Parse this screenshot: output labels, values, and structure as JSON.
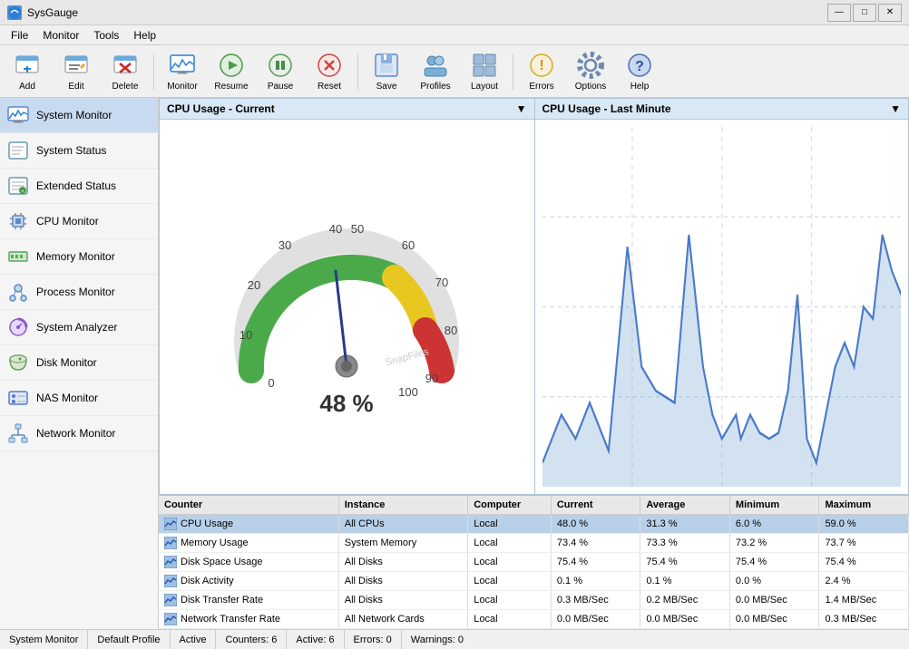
{
  "titleBar": {
    "title": "SysGauge",
    "minBtn": "—",
    "maxBtn": "□",
    "closeBtn": "✕"
  },
  "menuBar": {
    "items": [
      "File",
      "Monitor",
      "Tools",
      "Help"
    ]
  },
  "toolbar": {
    "buttons": [
      {
        "id": "add",
        "label": "Add"
      },
      {
        "id": "edit",
        "label": "Edit"
      },
      {
        "id": "delete",
        "label": "Delete"
      },
      {
        "id": "monitor",
        "label": "Monitor"
      },
      {
        "id": "resume",
        "label": "Resume"
      },
      {
        "id": "pause",
        "label": "Pause"
      },
      {
        "id": "reset",
        "label": "Reset"
      },
      {
        "id": "save",
        "label": "Save"
      },
      {
        "id": "profiles",
        "label": "Profiles"
      },
      {
        "id": "layout",
        "label": "Layout"
      },
      {
        "id": "errors",
        "label": "Errors"
      },
      {
        "id": "options",
        "label": "Options"
      },
      {
        "id": "help",
        "label": "Help"
      }
    ]
  },
  "sidebar": {
    "items": [
      {
        "id": "system-monitor",
        "label": "System Monitor",
        "active": true
      },
      {
        "id": "system-status",
        "label": "System Status"
      },
      {
        "id": "extended-status",
        "label": "Extended Status"
      },
      {
        "id": "cpu-monitor",
        "label": "CPU Monitor"
      },
      {
        "id": "memory-monitor",
        "label": "Memory Monitor"
      },
      {
        "id": "process-monitor",
        "label": "Process Monitor"
      },
      {
        "id": "system-analyzer",
        "label": "System Analyzer"
      },
      {
        "id": "disk-monitor",
        "label": "Disk Monitor"
      },
      {
        "id": "nas-monitor",
        "label": "NAS Monitor"
      },
      {
        "id": "network-monitor",
        "label": "Network Monitor"
      }
    ]
  },
  "charts": {
    "left": {
      "title": "CPU Usage - Current",
      "gaugeValue": 48,
      "gaugeLabel": "48 %",
      "min": 0,
      "max": 100
    },
    "right": {
      "title": "CPU Usage - Last Minute"
    }
  },
  "table": {
    "headers": [
      "Counter",
      "Instance",
      "Computer",
      "Current",
      "Average",
      "Minimum",
      "Maximum"
    ],
    "rows": [
      {
        "counter": "CPU Usage",
        "instance": "All CPUs",
        "computer": "Local",
        "current": "48.0 %",
        "average": "31.3 %",
        "minimum": "6.0 %",
        "maximum": "59.0 %",
        "selected": true
      },
      {
        "counter": "Memory Usage",
        "instance": "System Memory",
        "computer": "Local",
        "current": "73.4 %",
        "average": "73.3 %",
        "minimum": "73.2 %",
        "maximum": "73.7 %",
        "selected": false
      },
      {
        "counter": "Disk Space Usage",
        "instance": "All Disks",
        "computer": "Local",
        "current": "75.4 %",
        "average": "75.4 %",
        "minimum": "75.4 %",
        "maximum": "75.4 %",
        "selected": false
      },
      {
        "counter": "Disk Activity",
        "instance": "All Disks",
        "computer": "Local",
        "current": "0.1 %",
        "average": "0.1 %",
        "minimum": "0.0 %",
        "maximum": "2.4 %",
        "selected": false
      },
      {
        "counter": "Disk Transfer Rate",
        "instance": "All Disks",
        "computer": "Local",
        "current": "0.3 MB/Sec",
        "average": "0.2 MB/Sec",
        "minimum": "0.0 MB/Sec",
        "maximum": "1.4 MB/Sec",
        "selected": false
      },
      {
        "counter": "Network Transfer Rate",
        "instance": "All Network Cards",
        "computer": "Local",
        "current": "0.0 MB/Sec",
        "average": "0.0 MB/Sec",
        "minimum": "0.0 MB/Sec",
        "maximum": "0.3 MB/Sec",
        "selected": false
      }
    ]
  },
  "statusBar": {
    "monitor": "System Monitor",
    "profile": "Default Profile",
    "state": "Active",
    "counters": "Counters: 6",
    "active": "Active: 6",
    "errors": "Errors: 0",
    "warnings": "Warnings: 0"
  }
}
